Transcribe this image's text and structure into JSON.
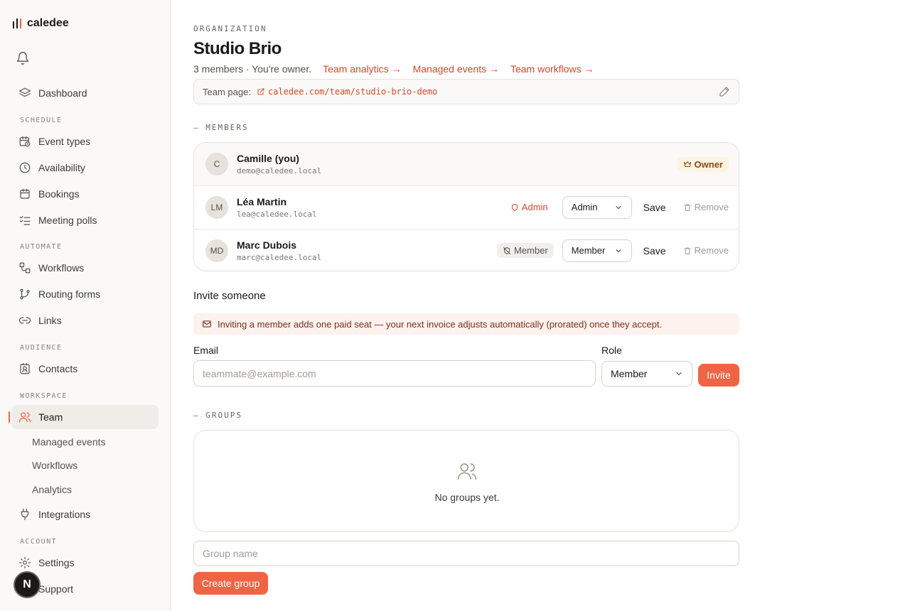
{
  "app": {
    "name": "caledee"
  },
  "sidebar": {
    "top_items": [
      {
        "label": "Dashboard",
        "icon": "layers-icon"
      }
    ],
    "sections": [
      {
        "title": "SCHEDULE",
        "items": [
          {
            "label": "Event types",
            "icon": "calendar-clock-icon"
          },
          {
            "label": "Availability",
            "icon": "clock-icon"
          },
          {
            "label": "Bookings",
            "icon": "calendar-icon"
          },
          {
            "label": "Meeting polls",
            "icon": "list-checks-icon"
          }
        ]
      },
      {
        "title": "AUTOMATE",
        "items": [
          {
            "label": "Workflows",
            "icon": "workflow-icon"
          },
          {
            "label": "Routing forms",
            "icon": "git-branch-icon"
          },
          {
            "label": "Links",
            "icon": "link-icon"
          }
        ]
      },
      {
        "title": "AUDIENCE",
        "items": [
          {
            "label": "Contacts",
            "icon": "contact-icon"
          }
        ]
      },
      {
        "title": "WORKSPACE",
        "items": [
          {
            "label": "Team",
            "icon": "users-icon",
            "active": true
          },
          {
            "label": "Integrations",
            "icon": "plug-icon"
          }
        ]
      },
      {
        "title": "ACCOUNT",
        "items": [
          {
            "label": "Settings",
            "icon": "gear-icon"
          },
          {
            "label": "Support",
            "icon": "life-buoy-icon"
          }
        ]
      }
    ],
    "team_subitems": [
      "Managed events",
      "Workflows",
      "Analytics"
    ],
    "fab_label": "N"
  },
  "header": {
    "eyebrow": "ORGANIZATION",
    "title": "Studio Brio",
    "summary": "3 members · You're owner.",
    "links": [
      "Team analytics →",
      "Managed events →",
      "Team workflows →"
    ],
    "team_page_label": "Team page:",
    "team_page_url": "caledee.com/team/studio-brio-demo"
  },
  "members": {
    "section_label": "— MEMBERS",
    "rows": [
      {
        "initials": "C",
        "name": "Camille (you)",
        "email": "demo@caledee.local",
        "badge": "Owner"
      },
      {
        "initials": "LM",
        "name": "Léa Martin",
        "email": "lea@caledee.local",
        "badge": "Admin",
        "role": "Admin",
        "save": "Save",
        "remove": "Remove"
      },
      {
        "initials": "MD",
        "name": "Marc Dubois",
        "email": "marc@caledee.local",
        "badge": "Member",
        "role": "Member",
        "save": "Save",
        "remove": "Remove"
      }
    ]
  },
  "invite": {
    "title": "Invite someone",
    "notice": "Inviting a member adds one paid seat — your next invoice adjusts automatically (prorated) once they accept.",
    "email_label": "Email",
    "email_placeholder": "teammate@example.com",
    "role_label": "Role",
    "role_value": "Member",
    "button": "Invite"
  },
  "groups": {
    "section_label": "— GROUPS",
    "empty_text": "No groups yet.",
    "name_placeholder": "Group name",
    "create_button": "Create group"
  },
  "colors": {
    "accent": "#ef6445",
    "accent_text": "#d9472a",
    "sidebar_bg": "#faf9f7"
  }
}
